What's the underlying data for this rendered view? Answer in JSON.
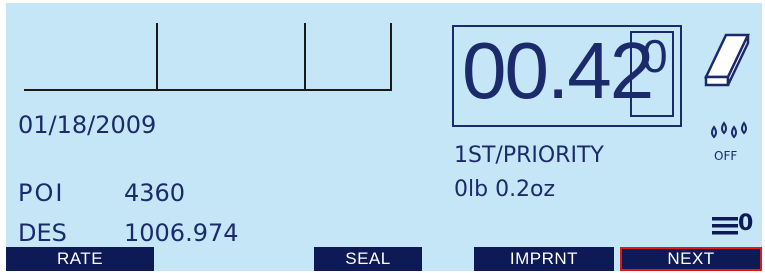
{
  "date": "01/18/2009",
  "poi": {
    "label": "POI",
    "value": "4360"
  },
  "des": {
    "label": "DES",
    "value": "1006.974"
  },
  "postage": {
    "main": "00.42",
    "fraction": "0"
  },
  "service": "1ST/PRIORITY",
  "weight": "0lb 0.2oz",
  "moistener": {
    "icon": "water-drops-icon",
    "status": "OFF"
  },
  "scale_icon": "scale-platform-icon",
  "menu_icon": "menu-lines-icon",
  "menu_count": "0",
  "softkeys": {
    "rate": "RATE",
    "seal": "SEAL",
    "imprint": "IMPRNT",
    "next": "NEXT"
  },
  "colors": {
    "screen": "#c5e6f7",
    "text": "#1b2a6b",
    "softkey": "#0d1a55",
    "highlight": "#e01818"
  }
}
